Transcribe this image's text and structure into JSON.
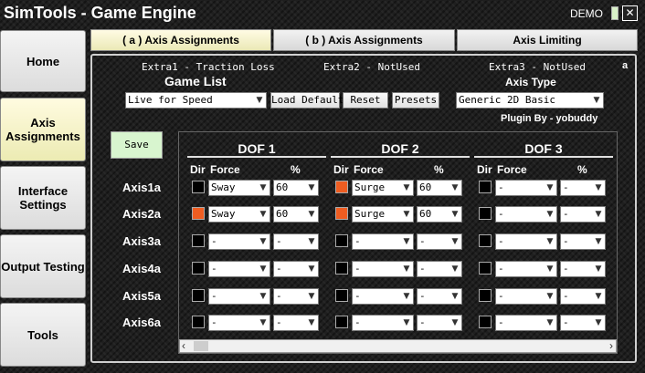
{
  "window": {
    "title_part1": "SimTools - ",
    "title_part2": "Game Engine",
    "mode_label": "DEMO",
    "close_glyph": "✕"
  },
  "sidebar": {
    "items": [
      {
        "label": "Home",
        "active": false
      },
      {
        "label": "Axis Assignments",
        "active": true
      },
      {
        "label": "Interface Settings",
        "active": false
      },
      {
        "label": "Output Testing",
        "active": false
      },
      {
        "label": "Tools",
        "active": false
      }
    ]
  },
  "tabs": [
    {
      "label": "( a ) Axis Assignments",
      "active": true
    },
    {
      "label": "( b ) Axis Assignments",
      "active": false
    },
    {
      "label": "Axis Limiting",
      "active": false
    }
  ],
  "extras": [
    "Extra1 - Traction Loss",
    "Extra2 - NotUsed",
    "Extra3 - NotUsed"
  ],
  "corner_mark": "a",
  "game_list": {
    "label": "Game List",
    "selected": "Live for Speed"
  },
  "buttons": {
    "load_default": "Load Default",
    "reset": "Reset",
    "presets": "Presets",
    "save": "Save"
  },
  "axis_type": {
    "label": "Axis Type",
    "selected": "Generic 2D Basic"
  },
  "plugin_by": "Plugin By - yobuddy",
  "dof_headers": [
    "DOF 1",
    "DOF 2",
    "DOF 3"
  ],
  "col_headers": {
    "dir": "Dir",
    "force": "Force",
    "percent": "%"
  },
  "axes": [
    {
      "name": "Axis1a",
      "cells": [
        {
          "dir": false,
          "force": "Sway",
          "pct": "60"
        },
        {
          "dir": true,
          "force": "Surge",
          "pct": "60"
        },
        {
          "dir": false,
          "force": "-",
          "pct": "-"
        }
      ]
    },
    {
      "name": "Axis2a",
      "cells": [
        {
          "dir": true,
          "force": "Sway",
          "pct": "60"
        },
        {
          "dir": true,
          "force": "Surge",
          "pct": "60"
        },
        {
          "dir": false,
          "force": "-",
          "pct": "-"
        }
      ]
    },
    {
      "name": "Axis3a",
      "cells": [
        {
          "dir": false,
          "force": "-",
          "pct": "-"
        },
        {
          "dir": false,
          "force": "-",
          "pct": "-"
        },
        {
          "dir": false,
          "force": "-",
          "pct": "-"
        }
      ]
    },
    {
      "name": "Axis4a",
      "cells": [
        {
          "dir": false,
          "force": "-",
          "pct": "-"
        },
        {
          "dir": false,
          "force": "-",
          "pct": "-"
        },
        {
          "dir": false,
          "force": "-",
          "pct": "-"
        }
      ]
    },
    {
      "name": "Axis5a",
      "cells": [
        {
          "dir": false,
          "force": "-",
          "pct": "-"
        },
        {
          "dir": false,
          "force": "-",
          "pct": "-"
        },
        {
          "dir": false,
          "force": "-",
          "pct": "-"
        }
      ]
    },
    {
      "name": "Axis6a",
      "cells": [
        {
          "dir": false,
          "force": "-",
          "pct": "-"
        },
        {
          "dir": false,
          "force": "-",
          "pct": "-"
        },
        {
          "dir": false,
          "force": "-",
          "pct": "-"
        }
      ]
    }
  ],
  "colors": {
    "dir_checked": "#ef5d21",
    "save_bg": "#d8f5cf"
  }
}
